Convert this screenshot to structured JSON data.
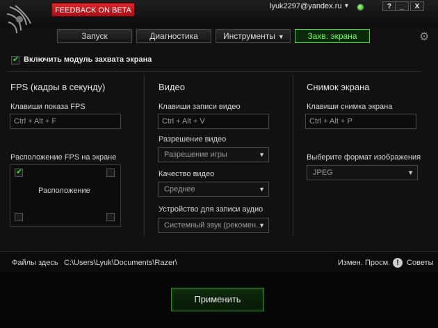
{
  "titlebar": {
    "feedback_label": "FEEDBACK ON BETA",
    "user": "lyuk2297@yandex.ru",
    "help": "?",
    "minimize": "_",
    "close": "X"
  },
  "tabs": [
    {
      "label": "Запуск"
    },
    {
      "label": "Диагностика"
    },
    {
      "label": "Инструменты"
    },
    {
      "label": "Захв. экрана"
    }
  ],
  "enable": {
    "label": "Включить модуль захвата экрана",
    "checked": true
  },
  "fps": {
    "header": "FPS (кадры в секунду)",
    "hotkey_label": "Клавиши показа FPS",
    "hotkey_value": "Ctrl + Alt + F",
    "position_label": "Расположение FPS на экране",
    "position_center": "Расположение",
    "selected_corner": "top-left"
  },
  "video": {
    "header": "Видео",
    "hotkey_label": "Клавиши записи видео",
    "hotkey_value": "Ctrl + Alt + V",
    "resolution_label": "Разрешение видео",
    "resolution_value": "Разрешение игры",
    "quality_label": "Качество видео",
    "quality_value": "Среднее",
    "audio_label": "Устройство для записи аудио",
    "audio_value": "Системный звук (рекомен..."
  },
  "screenshot": {
    "header": "Снимок экрана",
    "hotkey_label": "Клавиши снимка экрана",
    "hotkey_value": "Ctrl + Alt + P",
    "format_label": "Выберите формат изображения",
    "format_value": "JPEG"
  },
  "files": {
    "label": "Файлы здесь",
    "path": "C:\\Users\\Lyuk\\Documents\\Razer\\",
    "change": "Измен.",
    "view": "Просм.",
    "tips": "Советы"
  },
  "apply_label": "Применить",
  "colors": {
    "accent": "#3ddc2d",
    "feedback": "#d11d22"
  }
}
